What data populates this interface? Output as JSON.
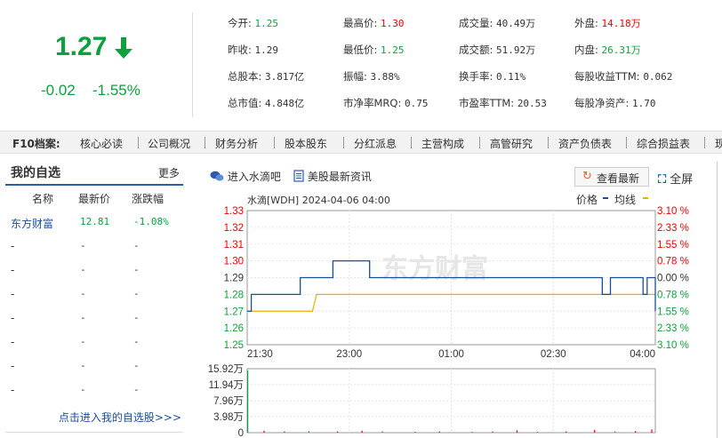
{
  "price": {
    "current": "1.27",
    "change": "-0.02",
    "change_pct": "-1.55%",
    "color_down": "#0e9f3e",
    "color_up": "#e00000"
  },
  "quote": [
    [
      {
        "label": "今开:",
        "value": "1.25",
        "tone": "green"
      },
      {
        "label": "最高价:",
        "value": "1.30",
        "tone": "red"
      },
      {
        "label": "成交量:",
        "value": "40.49万",
        "tone": ""
      },
      {
        "label": "外盘:",
        "value": "14.18万",
        "tone": "red"
      }
    ],
    [
      {
        "label": "昨收:",
        "value": "1.29",
        "tone": ""
      },
      {
        "label": "最低价:",
        "value": "1.25",
        "tone": "green"
      },
      {
        "label": "成交额:",
        "value": "51.92万",
        "tone": ""
      },
      {
        "label": "内盘:",
        "value": "26.31万",
        "tone": "green"
      }
    ],
    [
      {
        "label": "总股本:",
        "value": "3.817亿",
        "tone": ""
      },
      {
        "label": "振幅:",
        "value": "3.88%",
        "tone": ""
      },
      {
        "label": "换手率:",
        "value": "0.11%",
        "tone": ""
      },
      {
        "label": "每股收益TTM:",
        "value": "0.062",
        "tone": ""
      }
    ],
    [
      {
        "label": "总市值:",
        "value": "4.848亿",
        "tone": ""
      },
      {
        "label": "市净率MRQ:",
        "value": "0.75",
        "tone": ""
      },
      {
        "label": "市盈率TTM:",
        "value": "20.53",
        "tone": ""
      },
      {
        "label": "每股净资产:",
        "value": "1.70",
        "tone": ""
      }
    ]
  ],
  "f10": {
    "title": "F10档案:",
    "items": [
      "核心必读",
      "公司概况",
      "财务分析",
      "股本股东",
      "分红派息",
      "主营构成",
      "高管研究",
      "资产负债表",
      "综合损益表",
      "现"
    ]
  },
  "watchlist": {
    "title": "我的自选",
    "more": "更多",
    "headers": [
      "名称",
      "最新价",
      "涨跌幅"
    ],
    "rows": [
      {
        "name": "东方财富",
        "price": "12.81",
        "change": "-1.08%"
      },
      {
        "name": "-",
        "price": "-",
        "change": "-"
      },
      {
        "name": "-",
        "price": "-",
        "change": "-"
      },
      {
        "name": "-",
        "price": "-",
        "change": "-"
      },
      {
        "name": "-",
        "price": "-",
        "change": "-"
      },
      {
        "name": "-",
        "price": "-",
        "change": "-"
      },
      {
        "name": "-",
        "price": "-",
        "change": "-"
      },
      {
        "name": "-",
        "price": "-",
        "change": "-"
      }
    ],
    "footer": "点击进入我的自选股>>>"
  },
  "toolbar": {
    "water_link": "进入水滴吧",
    "us_news_link": "美股最新资讯",
    "latest_btn": "查看最新",
    "fullscreen_btn": "全屏"
  },
  "chart_data": {
    "type": "line",
    "title": "水滴[WDH] 2024-04-06 04:00",
    "legend": [
      "价格",
      "均线"
    ],
    "colors": {
      "price": "#1a4e9c",
      "avg": "#e8b000",
      "volume": "#0e9f3e"
    },
    "watermark": "东方财富",
    "y_left_ticks": [
      "1.33",
      "1.32",
      "1.31",
      "1.30",
      "1.29",
      "1.28",
      "1.27",
      "1.26",
      "1.25"
    ],
    "y_right_ticks": [
      "3.10 %",
      "2.33 %",
      "1.55 %",
      "0.78 %",
      "0.00 %",
      "0.78 %",
      "1.55 %",
      "2.33 %",
      "3.10 %"
    ],
    "ylim": [
      1.25,
      1.33
    ],
    "x_ticks": [
      "21:30",
      "23:00",
      "01:00",
      "02:30",
      "04:00"
    ],
    "price_x": [
      0,
      0.01,
      0.02,
      0.03,
      0.12,
      0.13,
      0.2,
      0.21,
      0.29,
      0.3,
      0.5,
      0.7,
      0.86,
      0.87,
      0.88,
      0.89,
      0.96,
      0.97,
      0.98,
      0.99,
      1.0
    ],
    "price_y": [
      1.27,
      1.28,
      1.28,
      1.28,
      1.28,
      1.29,
      1.29,
      1.3,
      1.3,
      1.29,
      1.29,
      1.29,
      1.29,
      1.28,
      1.28,
      1.29,
      1.29,
      1.28,
      1.29,
      1.29,
      1.27
    ],
    "avg_x": [
      0,
      0.16,
      0.17,
      1.0
    ],
    "avg_y": [
      1.27,
      1.27,
      1.28,
      1.28
    ],
    "volume_ticks": [
      "15.92万",
      "11.94万",
      "7.96万",
      "3.98万",
      "0"
    ],
    "volume_max": 15.92,
    "volume_x": [
      0.0,
      0.04,
      0.09,
      0.15,
      0.22,
      0.28,
      0.33,
      0.41,
      0.47,
      0.55,
      0.6,
      0.66,
      0.71,
      0.78,
      0.85,
      0.9,
      0.95,
      0.99
    ],
    "volume_y": [
      15.5,
      0.5,
      0.3,
      0.4,
      0.3,
      0.5,
      0.3,
      0.2,
      0.3,
      0.2,
      0.3,
      0.6,
      0.2,
      0.3,
      0.7,
      0.3,
      0.4,
      0.8
    ]
  }
}
